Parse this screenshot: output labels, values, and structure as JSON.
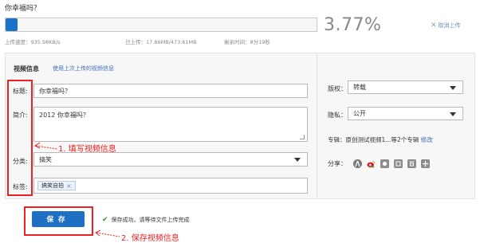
{
  "upload": {
    "title": "你幸福吗？",
    "progress_fraction": 0.0377,
    "percent_label": "3.77%",
    "cancel_label": "取消上传",
    "speed_label": "上传速度：935.98KB/s",
    "uploaded_label": "已上传：17.86MB/473.61MB",
    "remaining_label": "剩余时间：8分19秒"
  },
  "form": {
    "section_title": "视频信息",
    "use_last_link": "使用上次上传的视频信息",
    "title_label": "标题:",
    "title_value": "你幸福吗？",
    "desc_label": "简介:",
    "desc_value": "2012 你幸福吗？",
    "category_label": "分类:",
    "category_value": "搞笑",
    "tags_label": "标签:",
    "tags": [
      "搞笑自拍"
    ]
  },
  "side": {
    "copyright_label": "版权：",
    "copyright_value": "转载",
    "privacy_label": "隐私：",
    "privacy_value": "公开",
    "album_prefix": "专辑：原创测试视频1...等2个专辑",
    "album_edit_link": "修改",
    "share_label": "分享："
  },
  "footer": {
    "save_label": "保存",
    "success_message": "保存成功，请等待文件上传完成"
  },
  "annotations": {
    "fill_info": "1.  填写视频信息",
    "save_info": "2.  保存视频信息"
  },
  "colors": {
    "accent_blue": "#1f6fc5",
    "annotation_red": "#e22222",
    "success_green": "#2a9a2a"
  },
  "icons": {
    "cancel": "close-icon",
    "success": "checkmark-icon",
    "share": [
      "renren-icon",
      "weibo-icon",
      "qq-icon",
      "kaixin-icon",
      "douban-icon",
      "share-more-icon"
    ]
  }
}
